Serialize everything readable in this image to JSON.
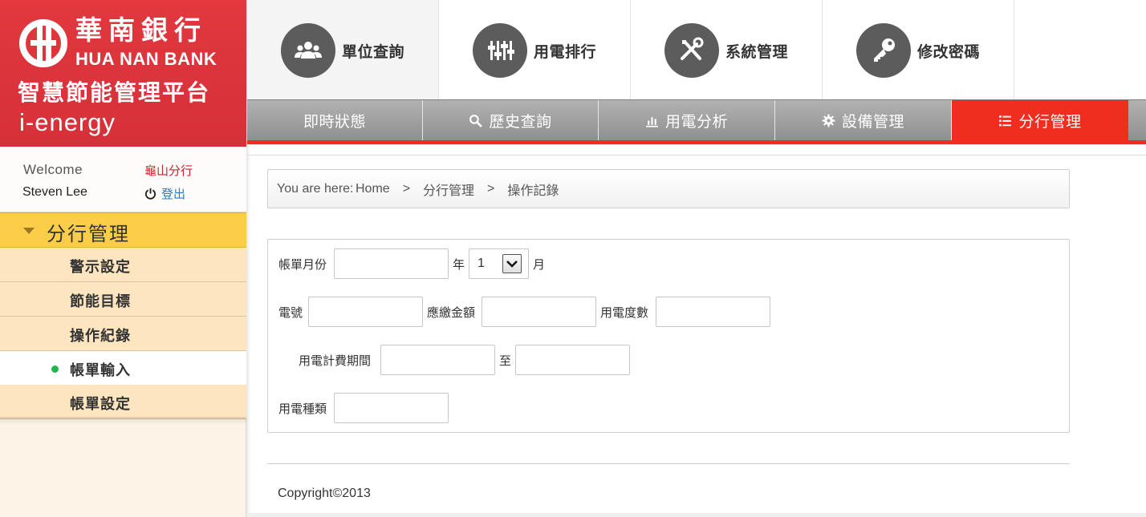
{
  "brand": {
    "name_cn": "華南銀行",
    "name_en": "HUA NAN BANK",
    "platform": "智慧節能管理平台",
    "product": "i-energy",
    "logo_icon": "hua-nan-bank-logo"
  },
  "user": {
    "welcome": "Welcome",
    "branch": "龜山分行",
    "name": "Steven Lee",
    "logout": "登出"
  },
  "sidebar": {
    "section_title": "分行管理",
    "items": [
      {
        "label": "警示設定",
        "active": false
      },
      {
        "label": "節能目標",
        "active": false
      },
      {
        "label": "操作紀錄",
        "active": false
      },
      {
        "label": "帳單輸入",
        "active": true
      },
      {
        "label": "帳單設定",
        "active": false
      }
    ]
  },
  "topnav": [
    {
      "label": "單位查詢",
      "icon": "users-icon"
    },
    {
      "label": "用電排行",
      "icon": "sliders-icon"
    },
    {
      "label": "系統管理",
      "icon": "tools-icon"
    },
    {
      "label": "修改密碼",
      "icon": "key-icon"
    }
  ],
  "tabs": [
    {
      "label": "即時狀態",
      "icon": ""
    },
    {
      "label": "歷史查詢",
      "icon": "search-icon"
    },
    {
      "label": "用電分析",
      "icon": "bar-chart-icon"
    },
    {
      "label": "設備管理",
      "icon": "gear-icon"
    },
    {
      "label": "分行管理",
      "icon": "list-icon",
      "active": true
    }
  ],
  "breadcrumb": {
    "prefix": "You are here:",
    "items": [
      "Home",
      "分行管理",
      "操作記錄"
    ],
    "separator": ">"
  },
  "form": {
    "bill_month_label": "帳單月份",
    "year_value": "",
    "year_suffix": "年",
    "month_value": "1",
    "month_suffix": "月",
    "meter_label": "電號",
    "meter_value": "",
    "amount_label": "應繳金額",
    "amount_value": "",
    "usage_label": "用電度數",
    "usage_value": "",
    "period_label": "用電計費期間",
    "period_from": "",
    "period_to_label": "至",
    "period_to": "",
    "type_label": "用電種類",
    "type_value": ""
  },
  "footer": {
    "copyright": "Copyright©2013"
  },
  "colors": {
    "brand_red": "#d6303a",
    "tab_active": "#ef2e20",
    "menu_head": "#fbcd49",
    "menu_item": "#fde5c0",
    "active_dot": "#23b44b"
  }
}
